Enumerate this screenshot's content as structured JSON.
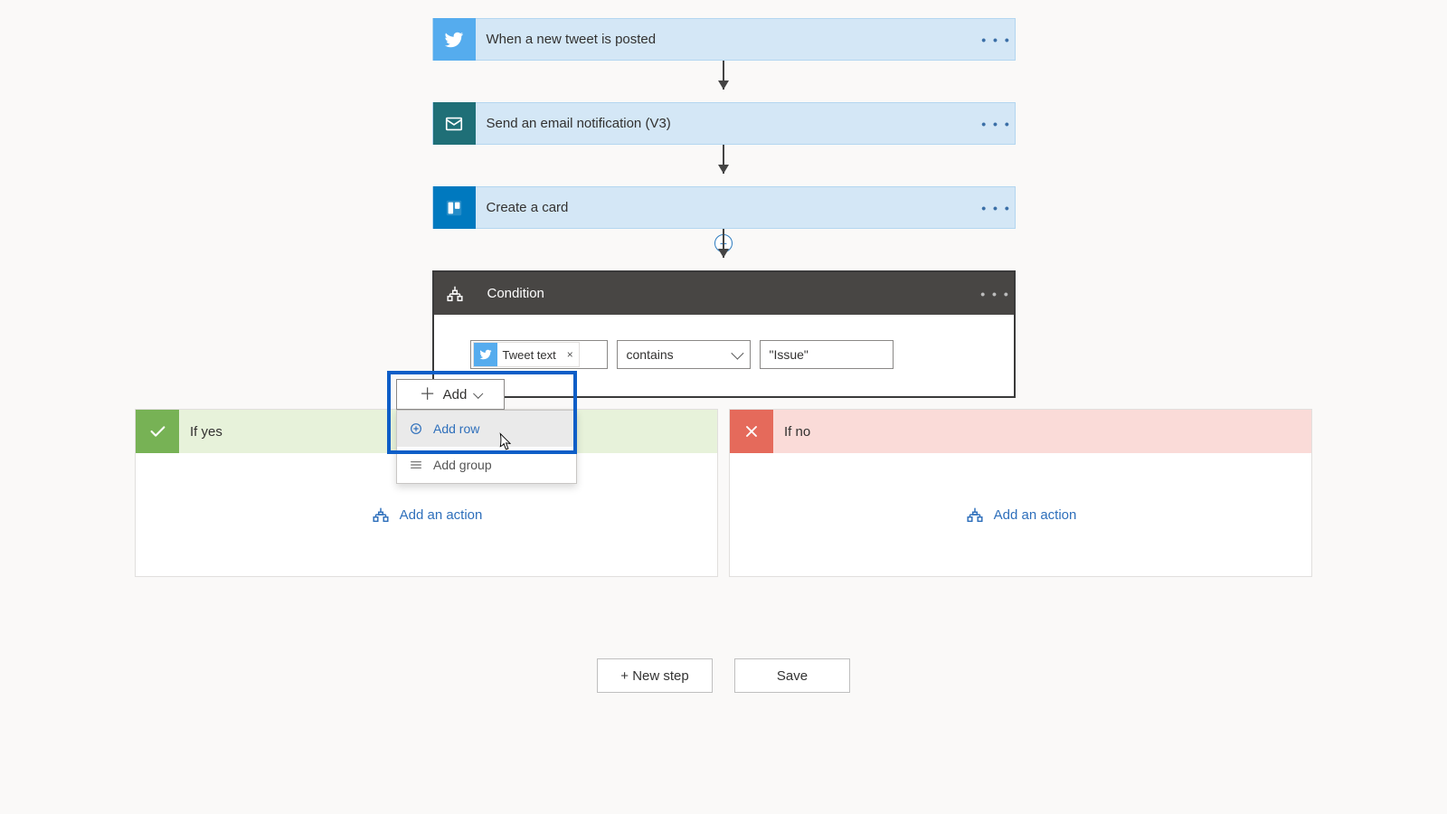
{
  "steps": {
    "twitter": {
      "title": "When a new tweet is posted"
    },
    "email": {
      "title": "Send an email notification (V3)"
    },
    "trello": {
      "title": "Create a card"
    }
  },
  "condition": {
    "title": "Condition",
    "token_label": "Tweet text",
    "operator": "contains",
    "value": "\"Issue\"",
    "add_label": "Add",
    "menu": {
      "add_row": "Add row",
      "add_group": "Add group"
    }
  },
  "branches": {
    "yes_label": "If yes",
    "no_label": "If no",
    "add_action": "Add an action"
  },
  "footer": {
    "new_step": "+ New step",
    "save": "Save"
  },
  "glyphs": {
    "dots": "• • •"
  }
}
